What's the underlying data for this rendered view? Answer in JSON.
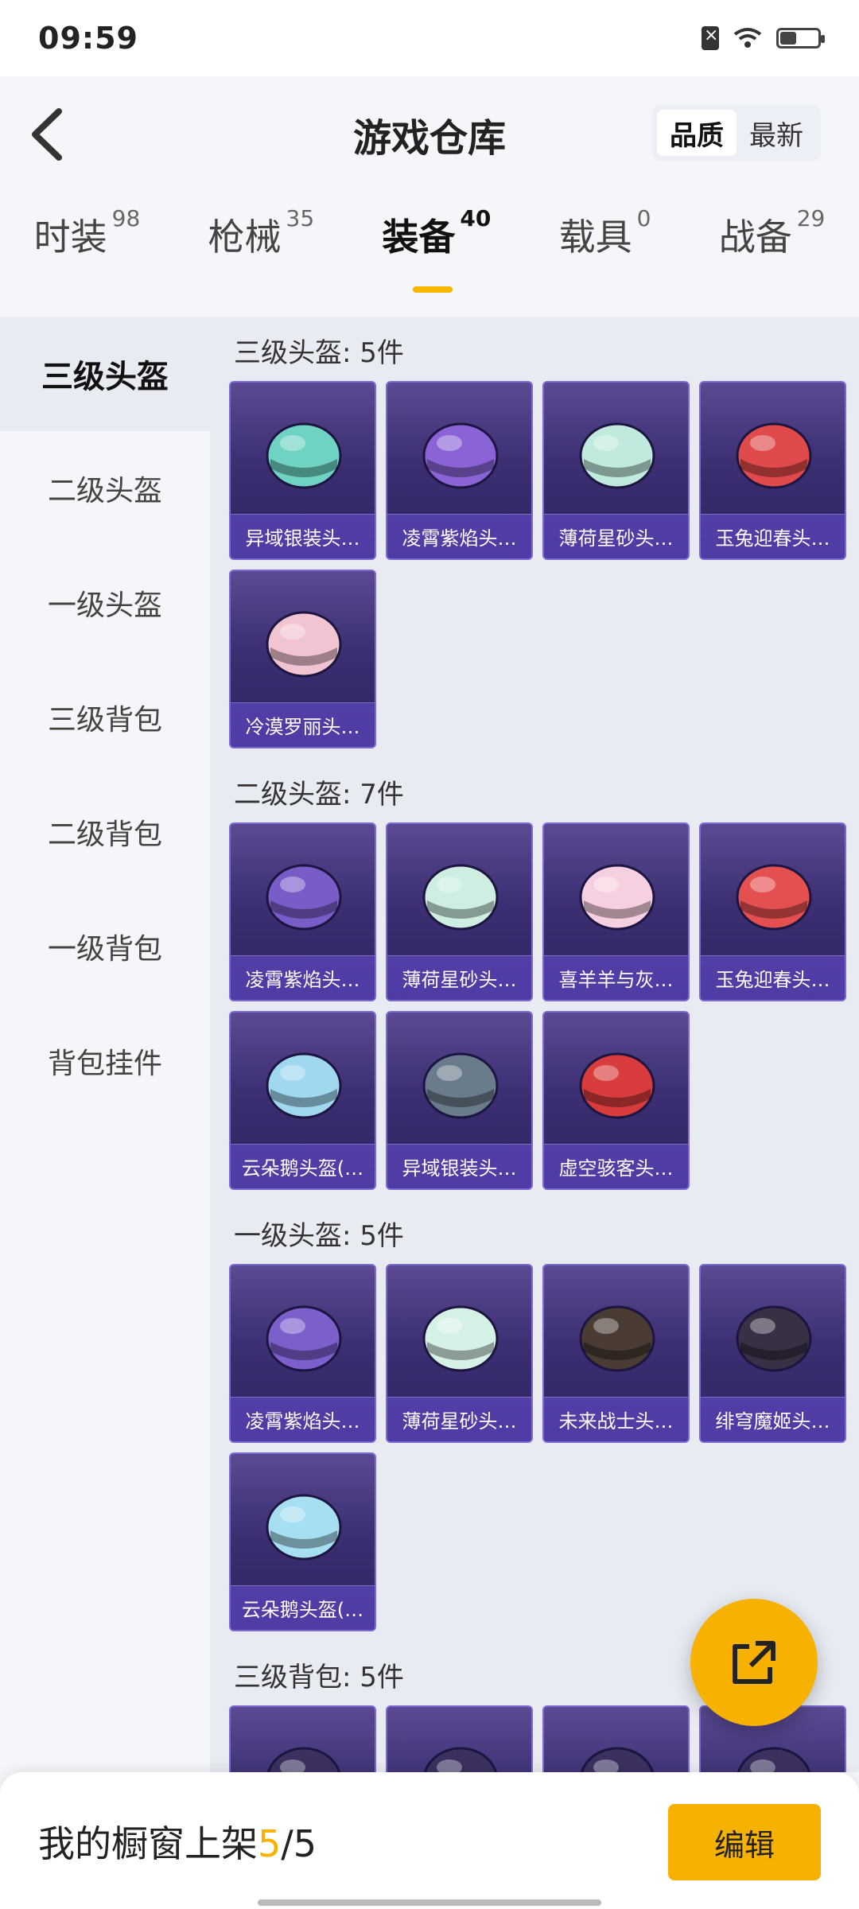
{
  "status": {
    "time": "09:59"
  },
  "header": {
    "title": "游戏仓库",
    "sort": [
      "品质",
      "最新"
    ]
  },
  "tabs": [
    {
      "label": "时装",
      "count": "98"
    },
    {
      "label": "枪械",
      "count": "35"
    },
    {
      "label": "装备",
      "count": "40"
    },
    {
      "label": "载具",
      "count": "0"
    },
    {
      "label": "战备",
      "count": "29"
    }
  ],
  "sidebar": [
    {
      "label": "三级头盔"
    },
    {
      "label": "二级头盔"
    },
    {
      "label": "一级头盔"
    },
    {
      "label": "三级背包"
    },
    {
      "label": "二级背包"
    },
    {
      "label": "一级背包"
    },
    {
      "label": "背包挂件"
    }
  ],
  "sections": [
    {
      "title": "三级头盔: 5件",
      "items": [
        "异域银装头…",
        "凌霄紫焰头…",
        "薄荷星砂头…",
        "玉兔迎春头…",
        "冷漠罗丽头…"
      ],
      "colors": [
        "#6fd3c4",
        "#8a64d6",
        "#bfeadd",
        "#e04a4a",
        "#f2c3d1"
      ]
    },
    {
      "title": "二级头盔: 7件",
      "items": [
        "凌霄紫焰头…",
        "薄荷星砂头…",
        "喜羊羊与灰…",
        "玉兔迎春头…",
        "云朵鹅头盔(…",
        "异域银装头…",
        "虚空骇客头…"
      ],
      "colors": [
        "#7a5cc8",
        "#cdeee0",
        "#f6cfe0",
        "#e45050",
        "#9fd8ef",
        "#6a7b8c",
        "#d83c3c"
      ]
    },
    {
      "title": "一级头盔: 5件",
      "items": [
        "凌霄紫焰头…",
        "薄荷星砂头…",
        "未来战士头…",
        "绯穹魔姬头…",
        "云朵鹅头盔(…"
      ],
      "colors": [
        "#7d5fcc",
        "#d6f2e6",
        "#4a3b33",
        "#3a3045",
        "#a7dff2"
      ]
    },
    {
      "title": "三级背包: 5件",
      "items": [
        "",
        "",
        "",
        ""
      ],
      "colors": [
        "#3b3060",
        "#3b3060",
        "#3b3060",
        "#3b3060"
      ]
    }
  ],
  "bottom": {
    "prefix": "我的橱窗上架",
    "count": "5",
    "total": "/5",
    "edit": "编辑"
  }
}
